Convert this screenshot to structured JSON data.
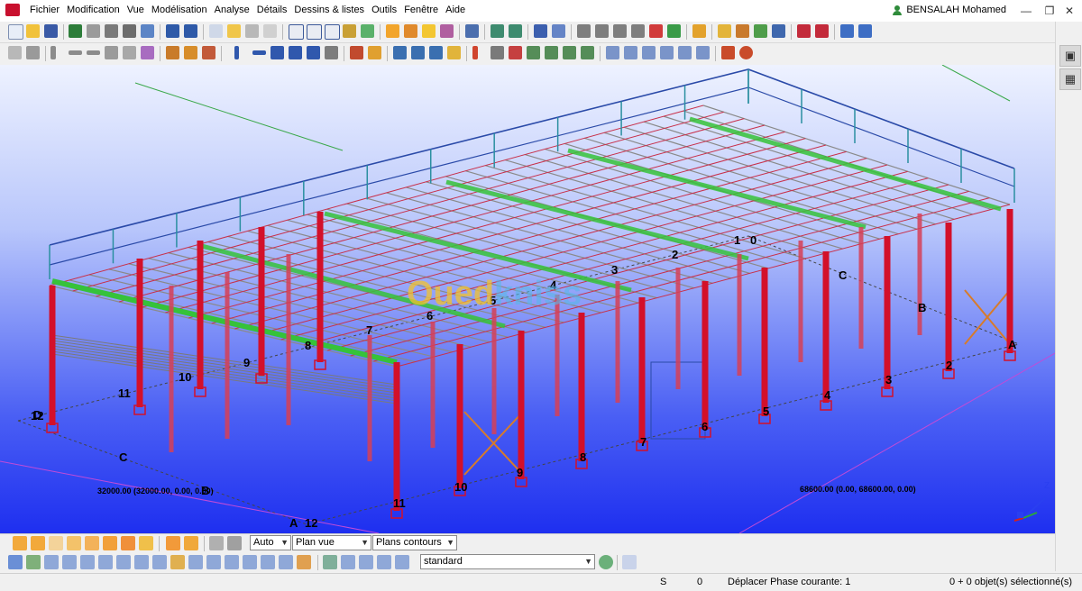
{
  "menu": {
    "items": [
      "Fichier",
      "Modification",
      "Vue",
      "Modélisation",
      "Analyse",
      "Détails",
      "Dessins & listes",
      "Outils",
      "Fenêtre",
      "Aide"
    ],
    "user": "BENSALAH Mohamed"
  },
  "viewport": {
    "watermark_left": "Oued",
    "watermark_right": "kniss",
    "left_dimension": "32000.00 (32000.00, 0.00, 0.00)",
    "right_dimension": "68600.00 (0.00, 68600.00, 0.00)",
    "grid_labels": {
      "d": "D",
      "c_left": "C",
      "b_left": "B",
      "a_bottom": "A",
      "n12_left": "12",
      "n12_bottom": "12",
      "n11_left": "11",
      "n10_left": "10",
      "n11_bottom": "11",
      "n10_bottom": "10",
      "n9": "9",
      "n8": "8",
      "n7": "7",
      "n6": "6",
      "n5": "5",
      "n4": "4",
      "n3": "3",
      "n2": "2",
      "n1": "1",
      "n0": "0",
      "c_right": "C",
      "b_right": "B",
      "a_right": "A",
      "r9": "9",
      "r8": "8",
      "r7": "7",
      "r6": "6",
      "r5": "5",
      "r4": "4",
      "r3": "3",
      "r2": "2"
    },
    "axis_z": "Z"
  },
  "bottom_toolbar": {
    "auto": "Auto",
    "plan_vue": "Plan vue",
    "plans_contours": "Plans contours",
    "standard": "standard"
  },
  "statusbar": {
    "s": "S",
    "zero": "0",
    "phase": "Déplacer Phase courante: 1",
    "selected": "0 + 0 objet(s) sélectionné(s)"
  },
  "colors": {
    "background_top": "#eef2ff",
    "background_bottom": "#1e2ff0",
    "column": "#d3102a",
    "purlin": "#8a8a8a",
    "green_beam": "#36c23a",
    "railing": "#2a4aa8",
    "bracing": "#d77b2a"
  }
}
